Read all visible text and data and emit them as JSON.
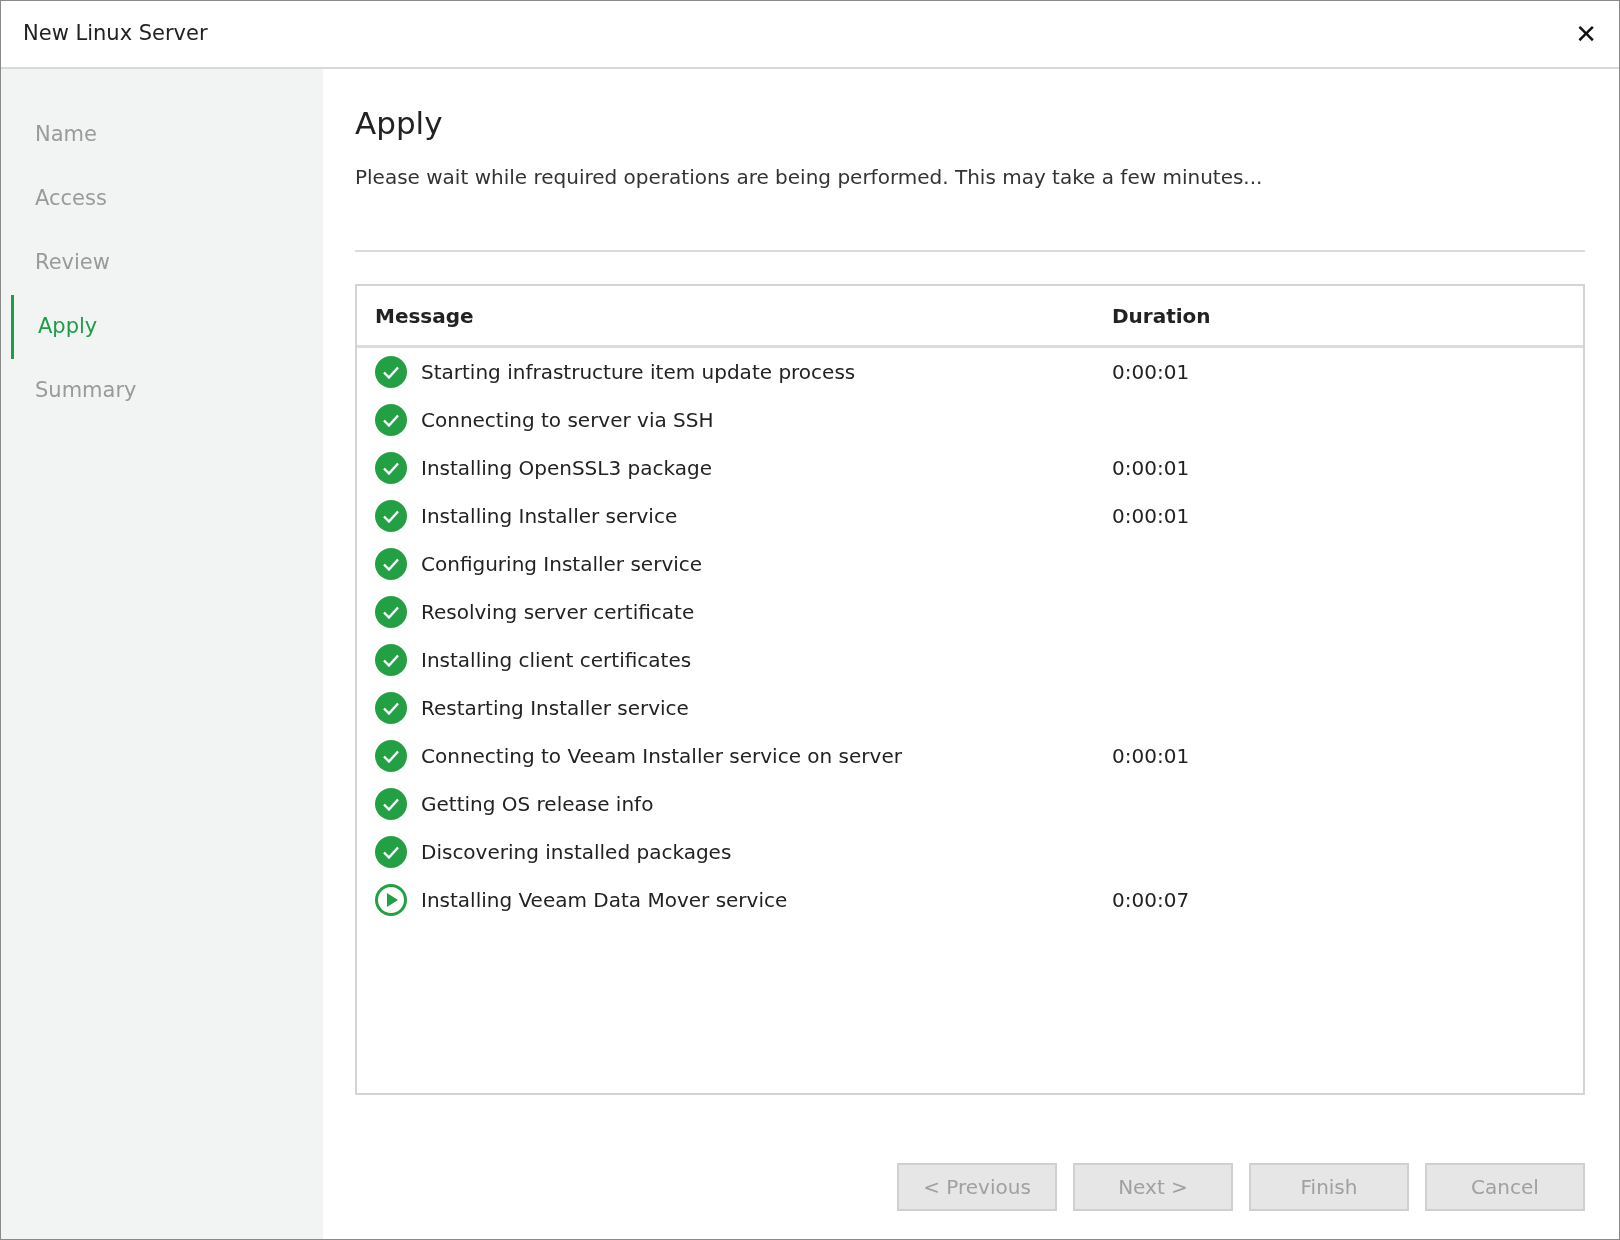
{
  "window": {
    "title": "New Linux Server",
    "close": "✕"
  },
  "steps": [
    {
      "label": "Name",
      "selected": false
    },
    {
      "label": "Access",
      "selected": false
    },
    {
      "label": "Review",
      "selected": false
    },
    {
      "label": "Apply",
      "selected": true
    },
    {
      "label": "Summary",
      "selected": false
    }
  ],
  "page": {
    "heading": "Apply",
    "description": "Please wait while required operations are being performed. This may take a few minutes..."
  },
  "table": {
    "columns": [
      "Message",
      "Duration"
    ],
    "rows": [
      {
        "kind": "done",
        "message": "Starting infrastructure item update process",
        "duration": "0:00:01"
      },
      {
        "kind": "done",
        "message": "Connecting to server via SSH"
      },
      {
        "kind": "done",
        "message": "Installing OpenSSL3 package",
        "duration": "0:00:01"
      },
      {
        "kind": "done",
        "message": "Installing Installer service",
        "duration": "0:00:01"
      },
      {
        "kind": "done",
        "message": "Configuring Installer service"
      },
      {
        "kind": "done",
        "message": "Resolving server certificate"
      },
      {
        "kind": "done",
        "message": "Installing client certificates"
      },
      {
        "kind": "done",
        "message": "Restarting Installer service"
      },
      {
        "kind": "done",
        "message": "Connecting to Veeam Installer service on server",
        "duration": "0:00:01"
      },
      {
        "kind": "done",
        "message": "Getting OS release info"
      },
      {
        "kind": "done",
        "message": "Discovering installed packages"
      },
      {
        "kind": "running",
        "message": "Installing Veeam Data Mover service",
        "duration": "0:00:07"
      }
    ]
  },
  "buttons": [
    {
      "label": "< Previous",
      "disabled": true
    },
    {
      "label": "Next >",
      "disabled": true
    },
    {
      "label": "Finish",
      "disabled": true
    },
    {
      "label": "Cancel",
      "disabled": true
    }
  ]
}
